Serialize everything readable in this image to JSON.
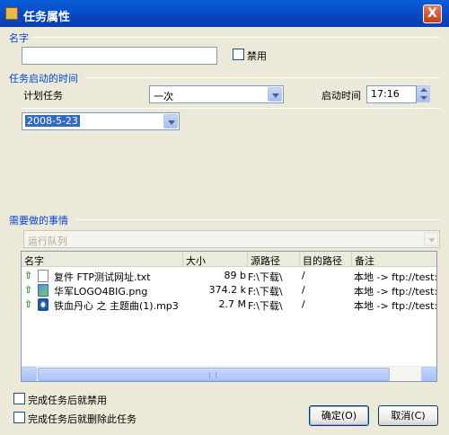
{
  "window": {
    "title": "任务属性",
    "close_label": "X"
  },
  "name_section": {
    "label": "名字",
    "name_value": "",
    "disable_label": "禁用"
  },
  "start_section": {
    "label": "任务启动的时间",
    "schedule_label": "计划任务",
    "schedule_value": "一次",
    "start_time_label": "启动时间",
    "start_time_value": "17:16",
    "date_value": "2008-5-23"
  },
  "todo_section": {
    "label": "需要做的事情",
    "action_value": "运行队列",
    "columns": [
      "名字",
      "大小",
      "源路径",
      "目的路径",
      "备注"
    ],
    "rows": [
      {
        "name": "复件 FTP测试网址.txt",
        "size": "89 b",
        "source": "F:\\下载\\",
        "dest": "/",
        "note": "本地 -> ftp://test:*",
        "icon": "text-file-icon"
      },
      {
        "name": "华军LOGO4BIG.png",
        "size": "374.2 k",
        "source": "F:\\下载\\",
        "dest": "/",
        "note": "本地 -> ftp://test:*",
        "icon": "image-file-icon"
      },
      {
        "name": "铁血丹心 之 主题曲(1).mp3",
        "size": "2.7 M",
        "source": "F:\\下载\\",
        "dest": "/",
        "note": "本地 -> ftp://test:*",
        "icon": "audio-file-icon"
      }
    ]
  },
  "options": {
    "disable_after_label": "完成任务后就禁用",
    "delete_after_label": "完成任务后就删除此任务"
  },
  "buttons": {
    "ok_label": "确定(O)",
    "cancel_label": "取消(C)"
  },
  "colors": {
    "section_label": "#0046d5",
    "titlebar": "#0a5fd8",
    "upload_arrow": "#18a018"
  }
}
